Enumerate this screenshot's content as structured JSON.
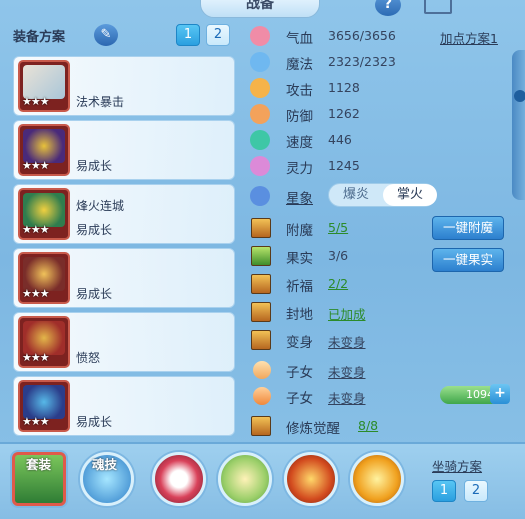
{
  "header": {
    "title": "战备",
    "help_glyph": "?"
  },
  "left": {
    "section_label": "装备方案",
    "plan_buttons": [
      "1",
      "2"
    ],
    "items": [
      {
        "line1": "",
        "line2": "法术暴击",
        "stars": "★★★"
      },
      {
        "line1": "",
        "line2": "易成长",
        "stars": "★★★"
      },
      {
        "line1": "烽火连城",
        "line2": "易成长",
        "stars": "★★★"
      },
      {
        "line1": "",
        "line2": "易成长",
        "stars": "★★★"
      },
      {
        "line1": "",
        "line2": "愤怒",
        "stars": "★★★"
      },
      {
        "line1": "",
        "line2": "易成长",
        "stars": "★★★"
      }
    ]
  },
  "stats": {
    "plan_link": "加点方案1",
    "rows": [
      {
        "label": "气血",
        "value": "3656/3656",
        "icon": "heart-icon",
        "color": "#f08ca7"
      },
      {
        "label": "魔法",
        "value": "2323/2323",
        "icon": "mana-icon",
        "color": "#6fb8f0"
      },
      {
        "label": "攻击",
        "value": "1128",
        "icon": "sword-icon",
        "color": "#f5b34a"
      },
      {
        "label": "防御",
        "value": "1262",
        "icon": "shield-icon",
        "color": "#f3a25b"
      },
      {
        "label": "速度",
        "value": "446",
        "icon": "speed-icon",
        "color": "#3ec7a6"
      },
      {
        "label": "灵力",
        "value": "1245",
        "icon": "spirit-icon",
        "color": "#dc8ad8"
      }
    ],
    "star_label": "星象",
    "star_options": [
      "爆炎",
      "掌火"
    ],
    "star_selected": "掌火",
    "enchant": {
      "label": "附魔",
      "value": "5/5"
    },
    "fruit": {
      "label": "果实",
      "value": "3/6"
    },
    "pray": {
      "label": "祈福",
      "value": "2/2"
    },
    "territory": {
      "label": "封地",
      "value": "已加成"
    },
    "transform": {
      "label": "变身",
      "value": "未变身"
    },
    "child1": {
      "label": "子女",
      "value": "未变身"
    },
    "child2": {
      "label": "子女",
      "value": "未变身"
    },
    "cultivate": {
      "label": "修炼觉醒",
      "value": "8/8"
    },
    "btn_enchant": "一键附魔",
    "btn_fruit": "一键果实",
    "exp_value": "1094",
    "plus_glyph": "+"
  },
  "bottom": {
    "suit_label": "套装",
    "soul_label": "魂技",
    "mount_label": "坐骑方案",
    "mount_buttons": [
      "1",
      "2"
    ]
  }
}
